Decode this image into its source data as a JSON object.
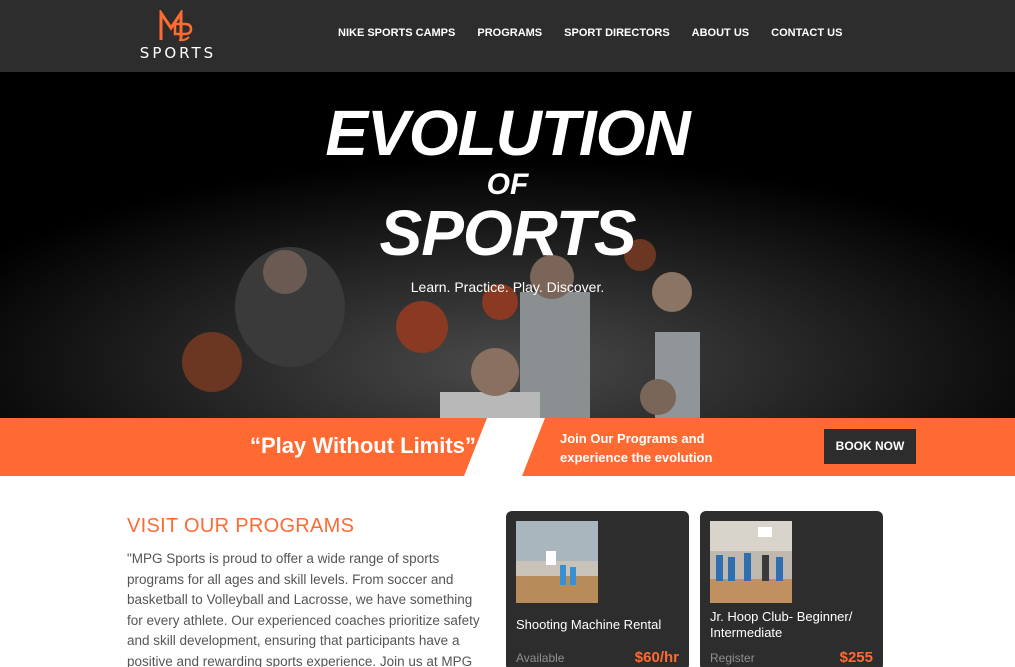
{
  "brand": {
    "logo_text": "SPORTS",
    "accent_color": "#ff6a33",
    "nav_bg": "#2d2d2d"
  },
  "nav": {
    "items": [
      {
        "label": "NIKE SPORTS CAMPS"
      },
      {
        "label": "PROGRAMS"
      },
      {
        "label": "SPORT DIRECTORS"
      },
      {
        "label": "ABOUT US"
      },
      {
        "label": "CONTACT US"
      }
    ]
  },
  "hero": {
    "title_line1": "EVOLUTION",
    "title_line2": "OF",
    "title_line3": "SPORTS",
    "subtitle": "Learn. Practice. Play. Discover."
  },
  "band": {
    "quote": "“Play Without Limits”",
    "cta_text": "Join Our Programs and experience the evolution",
    "book_button": "BOOK NOW"
  },
  "programs": {
    "heading": "VISIT OUR PROGRAMS",
    "body": "\"MPG Sports is proud to offer a wide range of sports programs for all ages and skill levels. From soccer and basketball to Volleyball and Lacrosse, we have something for every athlete. Our experienced coaches prioritize safety and skill development, ensuring that participants have a positive and rewarding sports experience. Join us at MPG Sports for",
    "cards": [
      {
        "title": "Shooting Machine Rental",
        "status": "Available",
        "price": "$60/hr"
      },
      {
        "title": "Jr. Hoop Club- Beginner/ Intermediate",
        "status": "Register",
        "price": "$255"
      }
    ]
  }
}
